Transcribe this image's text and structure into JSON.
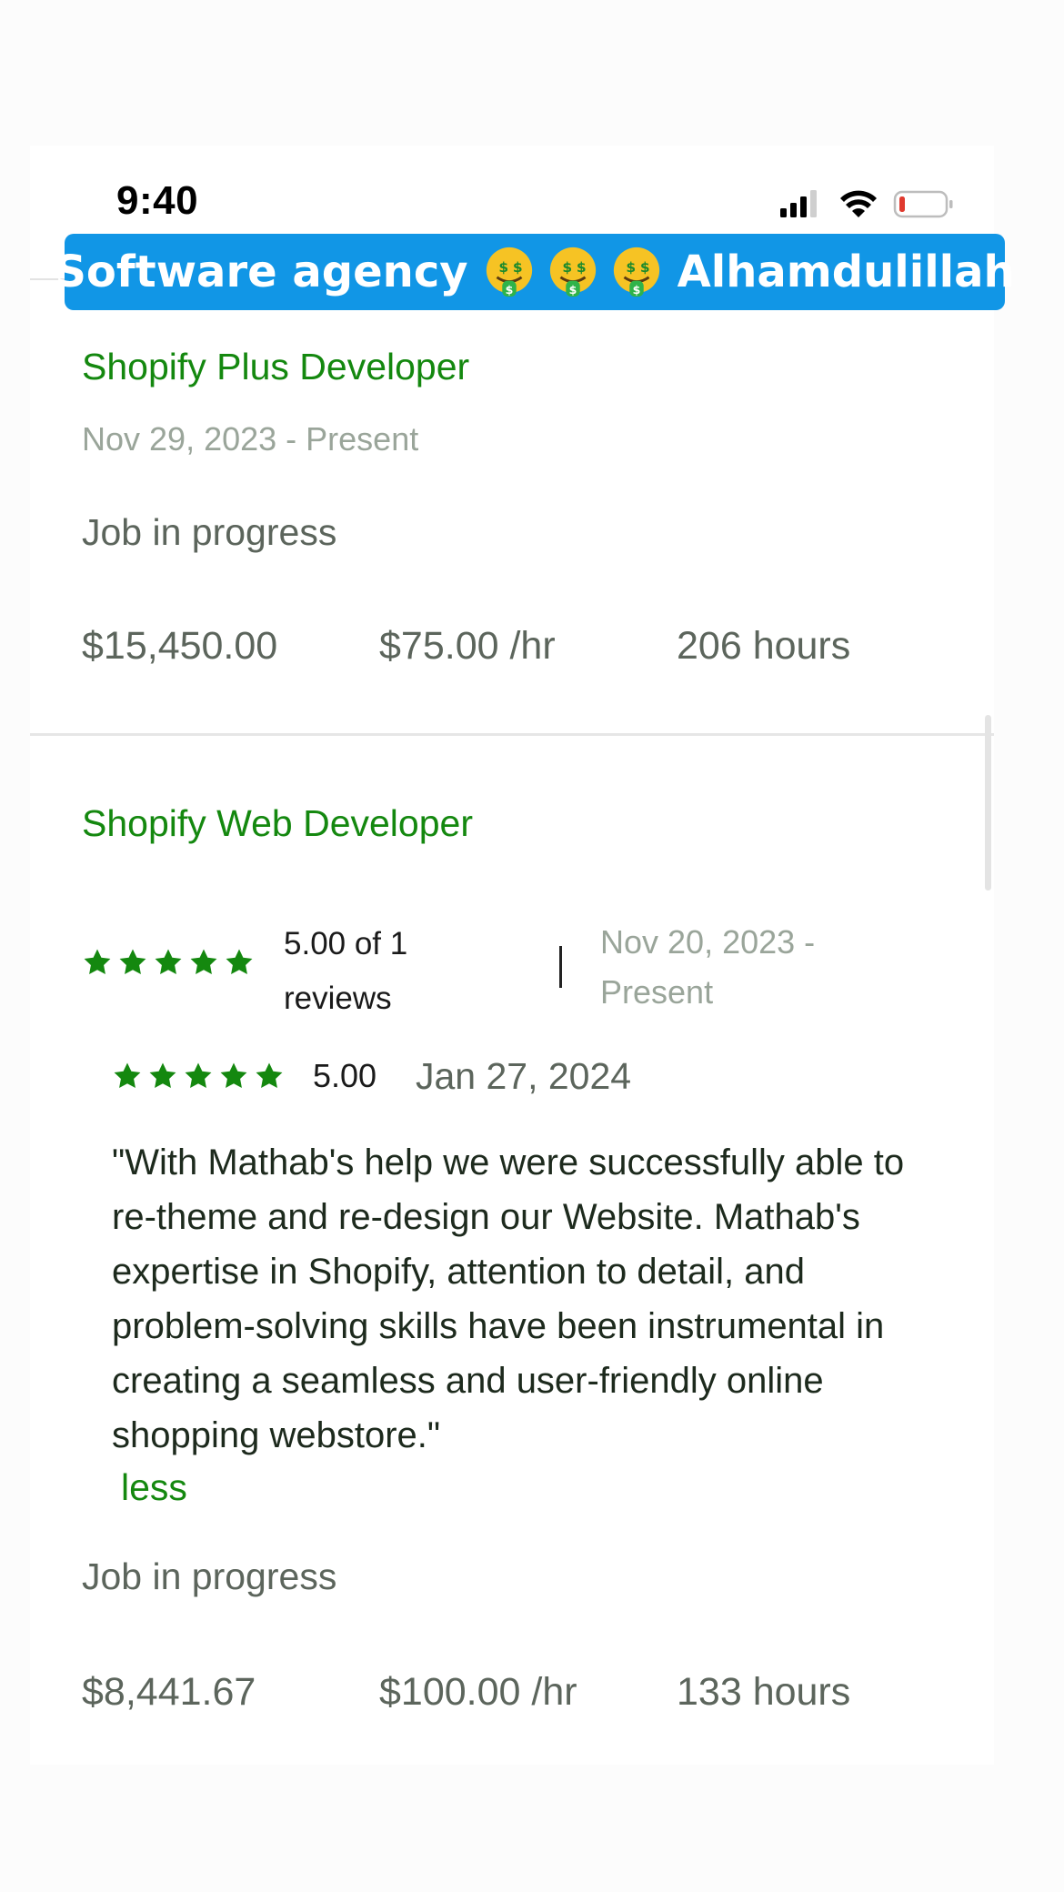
{
  "status_bar": {
    "time": "9:40"
  },
  "banner": {
    "text_before": "Software agency",
    "emojis": [
      "money-mouth-face",
      "money-mouth-face",
      "money-mouth-face"
    ],
    "text_after": "Alhamdulillah",
    "color": "#1196e6"
  },
  "jobs": [
    {
      "title": "Shopify Plus Developer",
      "dates": "Nov 29, 2023 - Present",
      "status": "Job in progress",
      "earned": "$15,450.00",
      "rate": "$75.00 /hr",
      "hours": "206 hours"
    },
    {
      "title": "Shopify Web Developer",
      "rating_summary": "5.00 of 1 reviews",
      "stars": 5,
      "dates": "Nov 20, 2023 - Present",
      "review": {
        "score": "5.00",
        "stars": 5,
        "date": "Jan 27, 2024",
        "text": "\"With Mathab's help we were successfully able to re-theme and re-design our Website. Mathab's expertise in Shopify, attention to detail, and problem-solving skills have been instrumental in creating a seamless and user-friendly online shopping webstore.\"",
        "less_label": "less"
      },
      "status": "Job in progress",
      "earned": "$8,441.67",
      "rate": "$100.00 /hr",
      "hours": "133 hours"
    }
  ],
  "colors": {
    "brand_green": "#14880f",
    "star_green": "#14880f",
    "muted_text": "#5c655c"
  }
}
